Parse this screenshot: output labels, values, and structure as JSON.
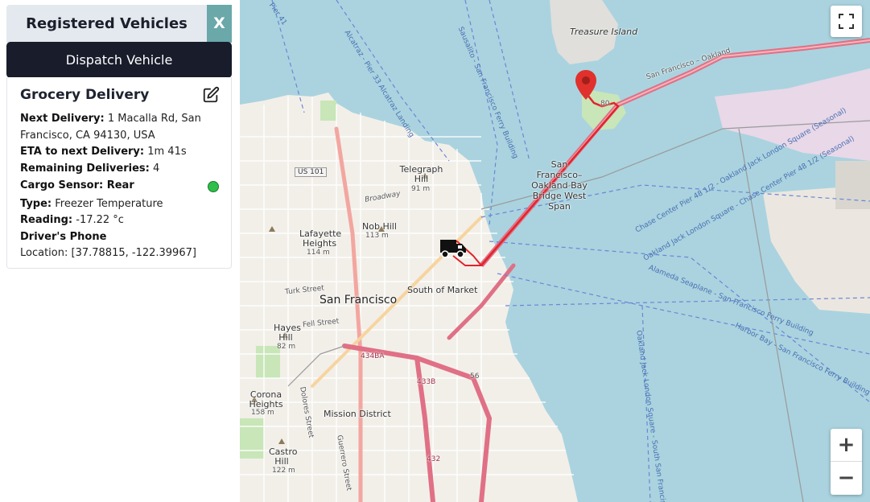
{
  "panel": {
    "title": "Registered Vehicles",
    "close_label": "X",
    "dispatch_label": "Dispatch Vehicle"
  },
  "vehicle": {
    "name": "Grocery Delivery",
    "next_delivery_label": "Next Delivery:",
    "next_delivery_value": "1 Macalla Rd, San Francisco, CA 94130, USA",
    "eta_label": "ETA to next Delivery:",
    "eta_value": "1m 41s",
    "remaining_label": "Remaining Deliveries:",
    "remaining_value": "4",
    "sensor_label": "Cargo Sensor: Rear",
    "sensor_status_color": "#2ec04a",
    "type_label": "Type:",
    "type_value": "Freezer Temperature",
    "reading_label": "Reading:",
    "reading_value": "-17.22 °c",
    "phone_label": "Driver's Phone",
    "location_label": "Location:",
    "location_value": "[37.78815, -122.39967]"
  },
  "map": {
    "zoom_in_label": "+",
    "zoom_out_label": "−",
    "route_color": "#e3232c",
    "marker_color": "#e0312c",
    "labels": {
      "treasure_island": "Treasure Island",
      "bay_bridge": "San Francisco–Oakland Bay Bridge West Span",
      "us101": "US 101",
      "telegraph_hill": "Telegraph Hill",
      "telegraph_elev": "91 m",
      "broadway": "Broadway",
      "nob_hill": "Nob Hill",
      "nob_elev": "113 m",
      "lafayette": "Lafayette Heights",
      "lafayette_elev": "114 m",
      "south_of_market": "South of Market",
      "san_francisco": "San Francisco",
      "turk": "Turk Street",
      "fell": "Fell Street",
      "hayes": "Hayes Hill",
      "hayes_elev": "82 m",
      "corona": "Corona Heights",
      "corona_elev": "158 m",
      "mission": "Mission District",
      "castro": "Castro Hill",
      "castro_elev": "122 m",
      "dolores": "Dolores Street",
      "guerrero": "Guerrero Street",
      "pier41": "Pier 41",
      "alcatraz": "Alcatraz - Pier 33 Alcatraz Landing",
      "sausalito": "Sausalito - San Francisco Ferry Building",
      "chase1": "Chase Center Pier 48 1/2 - Oakland Jack London Square (Seasonal)",
      "chase2": "Oakland Jack London Square - Chase Center Pier 48 1/2 (Seasonal)",
      "alameda": "Alameda Seaplane - San Francisco Ferry Building",
      "harbor": "Harbor Bay - San Francisco Ferry Building",
      "oakland_jack": "Oakland Jack London Square - South San Francisco",
      "sf_oakland": "San Francisco – Oakland",
      "s80a": "80",
      "r434": "434BA",
      "r433": "433B",
      "r432": "432",
      "r56": "56"
    }
  }
}
